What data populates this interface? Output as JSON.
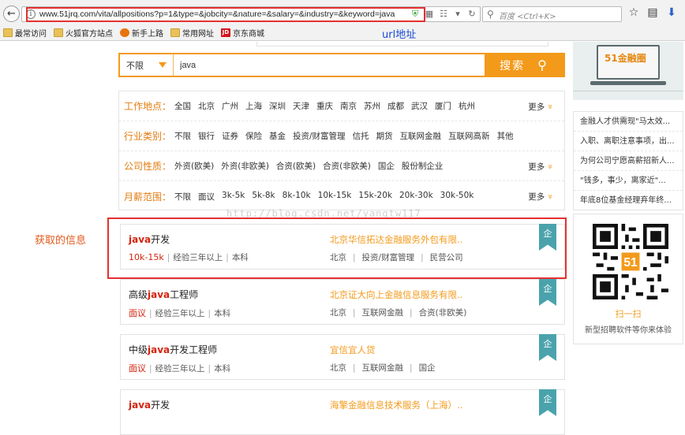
{
  "browser": {
    "url": "www.51jrq.com/vita/allpositions?p=1&type=&jobcity=&nature=&salary=&industry=&keyword=java",
    "search_placeholder": "百度 <Ctrl+K>",
    "bookmarks": [
      "最常访问",
      "火狐官方站点",
      "新手上路",
      "常用网址",
      "京东商城"
    ],
    "url_annotation": "url地址"
  },
  "search": {
    "select_value": "不限",
    "input_value": "java",
    "button_label": "搜索"
  },
  "filters": [
    {
      "label": "工作地点：",
      "options": [
        "全国",
        "北京",
        "广州",
        "上海",
        "深圳",
        "天津",
        "重庆",
        "南京",
        "苏州",
        "成都",
        "武汉",
        "厦门",
        "杭州"
      ],
      "more": "更多"
    },
    {
      "label": "行业类别：",
      "options": [
        "不限",
        "银行",
        "证券",
        "保险",
        "基金",
        "投资/财富管理",
        "信托",
        "期货",
        "互联网金融",
        "互联网高新",
        "其他"
      ],
      "more": ""
    },
    {
      "label": "公司性质：",
      "options": [
        "外资(欧美)",
        "外资(非欧美)",
        "合资(欧美)",
        "合资(非欧美)",
        "国企",
        "股份制企业"
      ],
      "more": "更多"
    },
    {
      "label": "月薪范围：",
      "options": [
        "不限",
        "面议",
        "3k-5k",
        "5k-8k",
        "8k-10k",
        "10k-15k",
        "15k-20k",
        "20k-30k",
        "30k-50k"
      ],
      "more": "更多"
    }
  ],
  "annotations": {
    "info_label": "获取的信息",
    "watermark": "http://blog.csdn.net/yangtw117"
  },
  "jobs": [
    {
      "title_kw": "java",
      "title_rest": "开发",
      "title_pre": "",
      "salary": "10k-15k",
      "experience": "经验三年以上",
      "education": "本科",
      "company": "北京华信拓达金融服务外包有限..",
      "city": "北京",
      "industry": "投资/财富管理",
      "nature": "民营公司",
      "badge": "企"
    },
    {
      "title_kw": "java",
      "title_rest": "工程师",
      "title_pre": "高级",
      "salary": "面议",
      "experience": "经验三年以上",
      "education": "本科",
      "company": "北京证大向上金融信息服务有限..",
      "city": "北京",
      "industry": "互联网金融",
      "nature": "合资(非欧美)",
      "badge": "企"
    },
    {
      "title_kw": "java",
      "title_rest": "开发工程师",
      "title_pre": "中级",
      "salary": "面议",
      "experience": "经验三年以上",
      "education": "本科",
      "company": "宜信宜人贷",
      "city": "北京",
      "industry": "互联网金融",
      "nature": "国企",
      "badge": "企"
    },
    {
      "title_kw": "java",
      "title_rest": "开发",
      "title_pre": "",
      "salary": "",
      "experience": "",
      "education": "",
      "company": "海擎金融信息技术服务（上海）..",
      "city": "",
      "industry": "",
      "nature": "",
      "badge": "企"
    }
  ],
  "sidebar": {
    "ad_text": "51金融圈",
    "news": [
      "金融人才供需现\"马太效...",
      "入职、离职注意事项，出...",
      "为何公司宁愿高薪招新人...",
      "\"钱多，事少，离家近\"...",
      "年底8位基金经理弃年终..."
    ],
    "qr_label": "扫一扫",
    "qr_caption": "新型招聘软件等你来体验"
  },
  "colors": {
    "accent": "#f39a1b",
    "keyword_red": "#d4240f",
    "badge_teal": "#4aa3ac",
    "highlight_red": "#e53030"
  }
}
